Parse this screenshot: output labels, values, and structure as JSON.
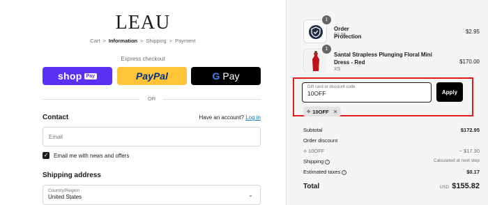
{
  "brand": {
    "logo_text": "LEAU"
  },
  "breadcrumb": {
    "items": [
      "Cart",
      "Information",
      "Shipping",
      "Payment"
    ],
    "separator": ">"
  },
  "express": {
    "label": "Express checkout",
    "shop_pay": {
      "word": "shop",
      "pay": "Pay"
    },
    "paypal": {
      "word": "PayPal"
    },
    "gpay": {
      "g": "G",
      "word": "Pay"
    },
    "or_label": "OR"
  },
  "contact": {
    "heading": "Contact",
    "have_account": "Have an account?",
    "login_link": "Log in",
    "email_placeholder": "Email",
    "news_checkbox_label": "Email me with news and offers",
    "news_checked": true
  },
  "shipping_address": {
    "heading": "Shipping address",
    "country_label": "Country/Region",
    "country_value": "United States"
  },
  "order": {
    "items": [
      {
        "name": "Order Protection",
        "sub": "$2.95",
        "price": "$2.95",
        "qty": "1",
        "icon": "shield-icon"
      },
      {
        "name": "Santal Strapless Plunging Floral Mini Dress - Red",
        "sub": "XS",
        "price": "$170.00",
        "qty": "1",
        "icon": "dress-image"
      }
    ],
    "discount": {
      "input_label": "Gift card or discount code",
      "input_value": "10OFF",
      "apply_label": "Apply",
      "applied_code": "10OFF",
      "highlight_color": "#e31b1b"
    },
    "summary": {
      "subtotal_label": "Subtotal",
      "subtotal_value": "$172.95",
      "order_discount_label": "Order discount",
      "discount_code_label": "10OFF",
      "discount_value": "− $17.30",
      "shipping_label": "Shipping",
      "shipping_value": "Calculated at next step",
      "taxes_label": "Estimated taxes",
      "taxes_value": "$0.17",
      "total_label": "Total",
      "total_currency": "USD",
      "total_value": "$155.82"
    }
  },
  "colors": {
    "shop_pay": "#5a31f4",
    "paypal": "#ffc439",
    "gpay": "#000000",
    "link": "#1773b0",
    "sidebar_bg": "#f5f5f5"
  }
}
